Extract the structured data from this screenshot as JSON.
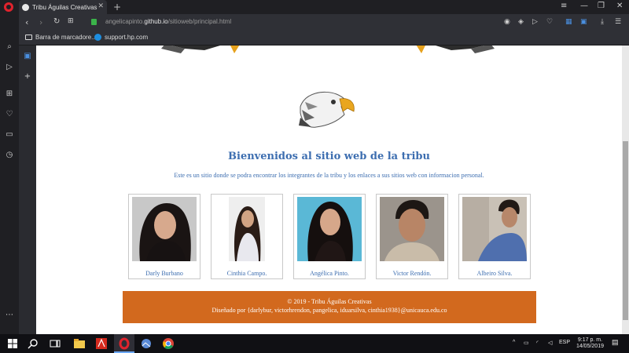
{
  "browser": {
    "tab_title": "Tribu Águilas Creativas",
    "url_prefix": "angelicapinto.",
    "url_host": "github.io",
    "url_path": "/sitioweb/principal.html",
    "bookmarks": [
      {
        "label": "Barra de marcadore..."
      },
      {
        "label": "support.hp.com"
      }
    ]
  },
  "page": {
    "heading": "Bienvenidos al sitio web de la tribu",
    "intro": "Este es un sitio donde se podra encontrar los integrantes de la tribu y los enlaces a sus sitios web con informacion personal.",
    "members": [
      {
        "name": "Darly Burbano"
      },
      {
        "name": "Cinthia Campo."
      },
      {
        "name": "Angélica Pinto."
      },
      {
        "name": "Victor Rendón."
      },
      {
        "name": "Albeiro Silva."
      }
    ],
    "footer_line1": "© 2019 - Tribu Águilas Creativas",
    "footer_line2": "Diseñado por {darlybur, victorhrendon, pangelica, iduarsilva, cinthia1938}@unicauca.edu.co"
  },
  "taskbar": {
    "lang": "ESP",
    "time": "9:17 p. m.",
    "date": "14/05/2019"
  },
  "colors": {
    "heading": "#3d6eb0",
    "footer_bg": "#d2691e"
  }
}
